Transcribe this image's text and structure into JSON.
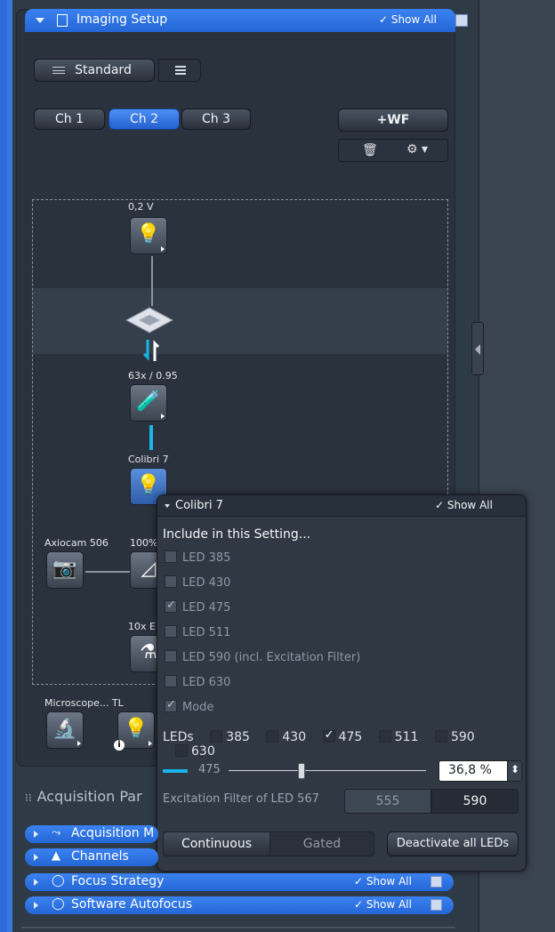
{
  "header": {
    "title": "Imaging Setup",
    "show_all": "✓ Show All"
  },
  "preset": {
    "label": "Standard"
  },
  "channels": [
    "Ch 1",
    "Ch 2",
    "Ch 3"
  ],
  "add_wf": "+WF",
  "diagram": {
    "top_lamp_label": "0,2 V",
    "objective_label": "63x / 0.95",
    "colibri_label": "Colibri 7",
    "camera_label": "Axiocam 506",
    "camera_pct": "100%",
    "lower_label": "10x E",
    "microscope_label": "Microscope... TL"
  },
  "popup": {
    "title": "Colibri 7",
    "show_all": "✓ Show All",
    "include_heading": "Include in this Setting...",
    "include_items": [
      {
        "label": "LED 385",
        "checked": false
      },
      {
        "label": "LED 430",
        "checked": false
      },
      {
        "label": "LED 475",
        "checked": true
      },
      {
        "label": "LED 511",
        "checked": false
      },
      {
        "label": "LED 590 (incl. Excitation Filter)",
        "checked": false
      },
      {
        "label": "LED 630",
        "checked": false
      },
      {
        "label": "Mode",
        "checked": true
      }
    ],
    "leds_label": "LEDs",
    "leds": [
      {
        "label": "385",
        "checked": false
      },
      {
        "label": "430",
        "checked": false
      },
      {
        "label": "475",
        "checked": true
      },
      {
        "label": "511",
        "checked": false
      },
      {
        "label": "590",
        "checked": false
      },
      {
        "label": "630",
        "checked": false
      }
    ],
    "slider_led": "475",
    "intensity_level": 0.368,
    "intensity_value": "36,8 %",
    "excitation_label": "Excitation Filter of LED 567",
    "excitation_options": [
      "555",
      "590"
    ],
    "excitation_selected": "590",
    "mode_options": [
      "Continuous",
      "Gated"
    ],
    "mode_selected": "Continuous",
    "deactivate_label": "Deactivate all LEDs"
  },
  "acquisition": {
    "heading": "Acquisition Par",
    "rows": [
      {
        "label": "Acquisition M",
        "icon": "acquisition-mode-icon"
      },
      {
        "label": "Channels",
        "icon": "channels-icon"
      },
      {
        "label": "Focus Strategy",
        "icon": "focus-strategy-icon",
        "show_all": "✓ Show All"
      },
      {
        "label": "Software Autofocus",
        "icon": "software-autofocus-icon",
        "show_all": "✓ Show All"
      }
    ]
  }
}
